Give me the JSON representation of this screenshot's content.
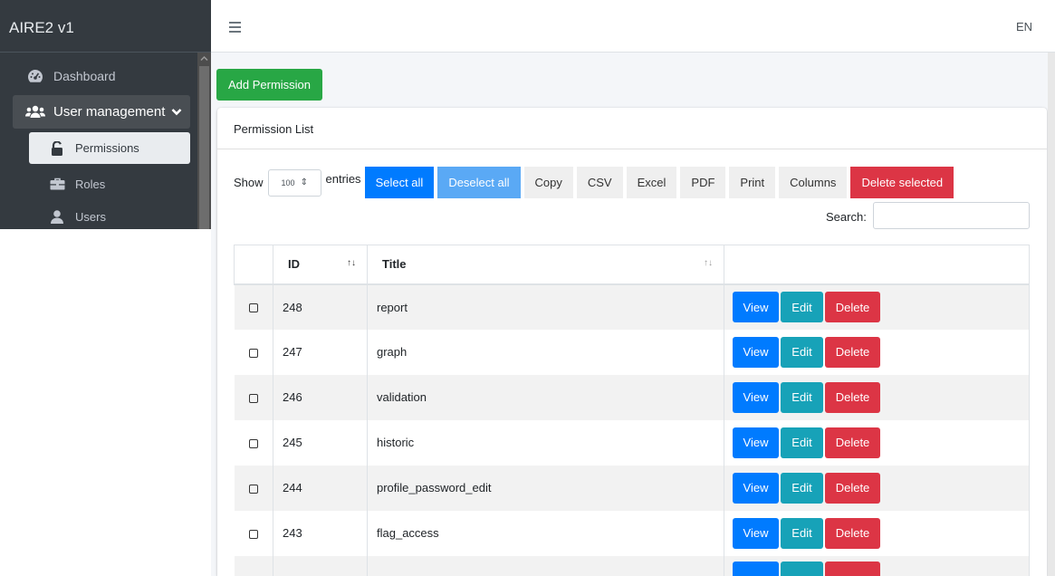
{
  "sidebar": {
    "brand": "AIRE2 v1",
    "items": [
      {
        "label": "Dashboard",
        "icon": "dashboard-gauge-icon"
      },
      {
        "label": "User management",
        "icon": "users-icon",
        "expanded": true
      },
      {
        "label": "Permissions",
        "icon": "unlock-icon",
        "active": true
      },
      {
        "label": "Roles",
        "icon": "briefcase-icon"
      },
      {
        "label": "Users",
        "icon": "user-icon"
      }
    ]
  },
  "topbar": {
    "language": "EN"
  },
  "main": {
    "add_button": "Add Permission",
    "card_title": "Permission List",
    "controls": {
      "show_label": "Show",
      "page_length": "100",
      "entries_label": "entries",
      "buttons": [
        "Select all",
        "Deselect all",
        "Copy",
        "CSV",
        "Excel",
        "PDF",
        "Print",
        "Columns",
        "Delete selected"
      ],
      "search_label": "Search:"
    },
    "table": {
      "columns": [
        "",
        "ID",
        "Title",
        ""
      ],
      "action_labels": {
        "view": "View",
        "edit": "Edit",
        "delete": "Delete"
      },
      "rows": [
        {
          "id": "248",
          "title": "report"
        },
        {
          "id": "247",
          "title": "graph"
        },
        {
          "id": "246",
          "title": "validation"
        },
        {
          "id": "245",
          "title": "historic"
        },
        {
          "id": "244",
          "title": "profile_password_edit"
        },
        {
          "id": "243",
          "title": "flag_access"
        }
      ]
    }
  },
  "colors": {
    "sidebar_bg": "#343a40",
    "success": "#28a745",
    "primary": "#007bff",
    "info": "#17a2b8",
    "danger": "#dc3545"
  }
}
